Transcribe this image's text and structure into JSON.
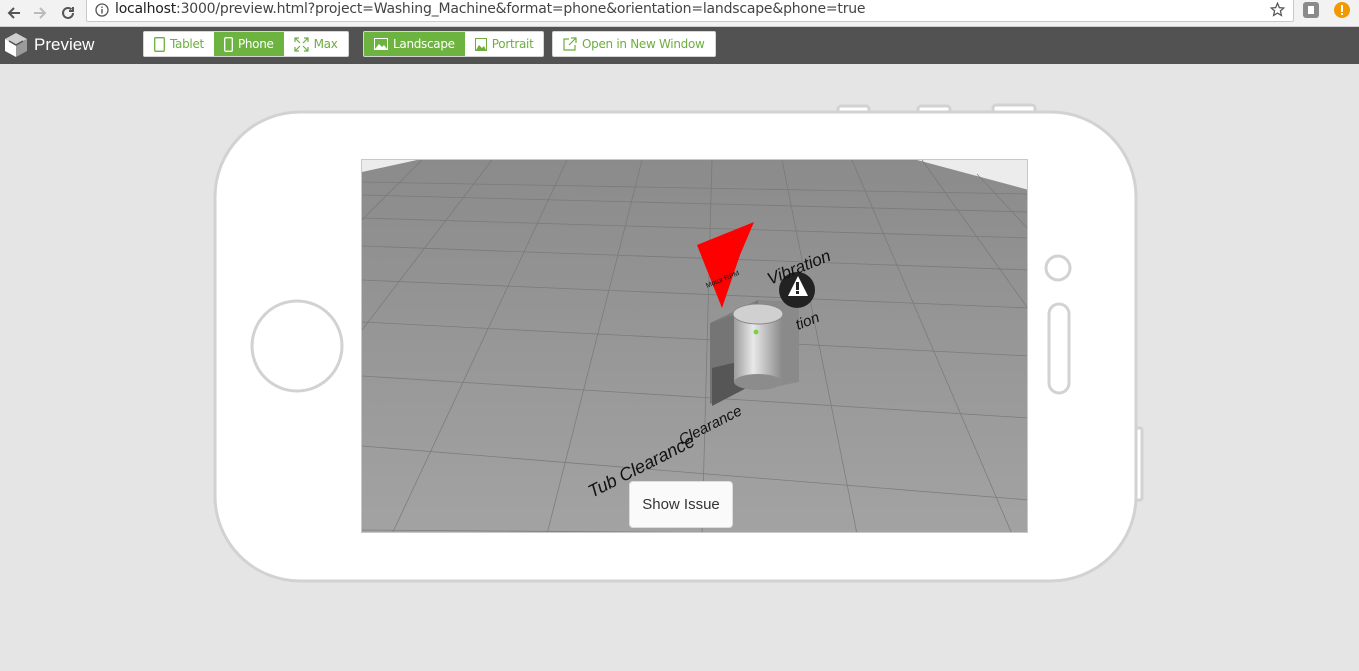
{
  "browser": {
    "url_host": "localhost",
    "url_rest": ":3000/preview.html?project=Washing_Machine&format=phone&orientation=landscape&phone=true"
  },
  "toolbar": {
    "brand_label": "Preview",
    "format_buttons": [
      {
        "label": "Tablet",
        "icon": "tablet-icon",
        "active": false
      },
      {
        "label": "Phone",
        "icon": "phone-icon",
        "active": true
      },
      {
        "label": "Max",
        "icon": "expand-icon",
        "active": false
      }
    ],
    "orientation_buttons": [
      {
        "label": "Landscape",
        "icon": "landscape-image-icon",
        "active": true
      },
      {
        "label": "Portrait",
        "icon": "portrait-image-icon",
        "active": false
      }
    ],
    "open_window_label": "Open in New Window",
    "accent_color": "#6cb33f"
  },
  "scene": {
    "labels": {
      "vibration": "Vibration",
      "vibration_partial": "tion",
      "rpm": "Motor RPM",
      "tub_clearance": "Tub Clearance",
      "tub_clearance_overlap": "Clearance"
    },
    "arrow_color": "#ff0000"
  },
  "show_issue_label": "Show Issue"
}
